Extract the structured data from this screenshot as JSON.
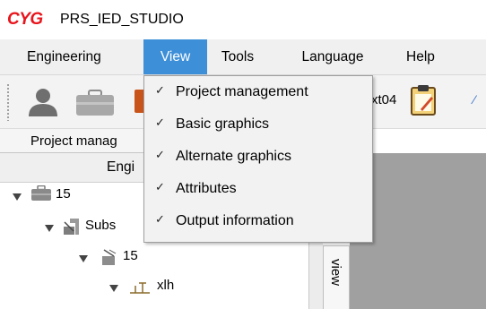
{
  "app": {
    "logo": "CYG",
    "title": "PRS_IED_STUDIO"
  },
  "menubar": {
    "items": [
      "Engineering",
      "View",
      "Tools",
      "Language",
      "Help"
    ]
  },
  "view_menu": {
    "items": [
      {
        "label": "Project management",
        "checked": true
      },
      {
        "label": "Basic graphics",
        "checked": true
      },
      {
        "label": "Alternate graphics",
        "checked": true
      },
      {
        "label": "Attributes",
        "checked": true
      },
      {
        "label": "Output information",
        "checked": true
      }
    ],
    "check_glyph": "✓"
  },
  "toolbar": {
    "text_fragment": "xt04",
    "icons": [
      "user-icon",
      "briefcase-icon",
      "orange-icon",
      "clipboard-icon",
      "extra-icon"
    ]
  },
  "left_panel": {
    "tab_label": "Project manag",
    "header_label": "Engi",
    "tree": [
      {
        "label": "15",
        "icon": "briefcase-icon",
        "level": 0
      },
      {
        "label": "Subs",
        "icon": "substation-icon",
        "level": 1
      },
      {
        "label": "15",
        "icon": "voltage-level-icon",
        "level": 2
      },
      {
        "label": "xlh",
        "icon": "bay-icon",
        "level": 3
      }
    ]
  },
  "side_tab": {
    "label": "view"
  },
  "colors": {
    "menu_highlight": "#3d8fd8",
    "logo": "#e8141c",
    "workspace": "#a0a0a0"
  }
}
